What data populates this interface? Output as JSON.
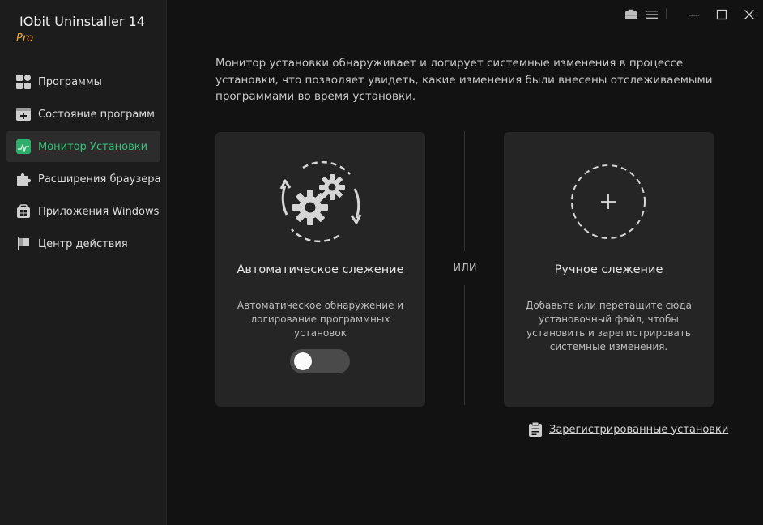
{
  "app": {
    "title": "IObit Uninstaller 14",
    "edition": "Pro"
  },
  "sidebar": {
    "items": [
      {
        "label": "Программы",
        "icon": "programs-grid-icon",
        "active": false
      },
      {
        "label": "Состояние программ",
        "icon": "program-status-icon",
        "active": false
      },
      {
        "label": "Монитор Установки",
        "icon": "install-monitor-icon",
        "active": true
      },
      {
        "label": "Расширения браузера",
        "icon": "puzzle-icon",
        "active": false
      },
      {
        "label": "Приложения Windows",
        "icon": "windows-apps-icon",
        "active": false
      },
      {
        "label": "Центр действия",
        "icon": "flag-icon",
        "active": false
      }
    ]
  },
  "window": {
    "controls": [
      "toolbox-icon",
      "menu-icon",
      "minimize-icon",
      "maximize-icon",
      "close-icon"
    ]
  },
  "main": {
    "intro": "Монитор установки обнаруживает и логирует системные изменения в процессе установки, что позволяет увидеть, какие изменения были внесены отслеживаемыми программами во время установки.",
    "separator": "ИЛИ",
    "auto": {
      "title": "Автоматическое слежение",
      "description": "Автоматическое обнаружение и логирование программных установок",
      "enabled": false
    },
    "manual": {
      "title": "Ручное слежение",
      "description": "Добавьте или перетащите сюда установочный файл, чтобы установить и зарегистрировать системные изменения."
    },
    "registered_link": "Зарегистрированные установки"
  },
  "colors": {
    "accent": "#39c07a",
    "pro": "#e7a93a",
    "background": "#121212",
    "sidebar": "#1c1c1c",
    "card": "#252525"
  }
}
